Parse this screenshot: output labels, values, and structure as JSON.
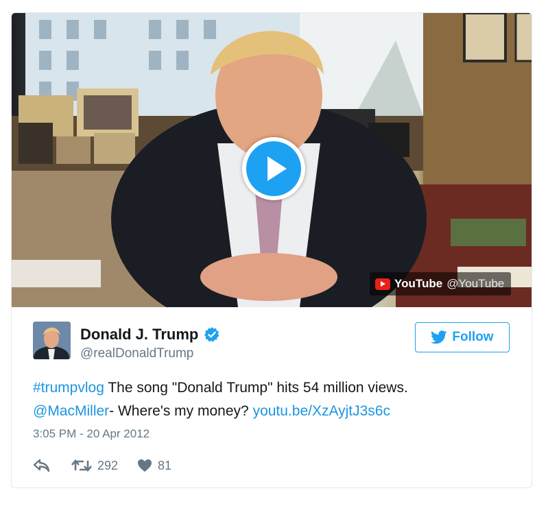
{
  "media": {
    "badge_brand": "YouTube",
    "badge_handle": "@YouTube"
  },
  "user": {
    "name": "Donald J. Trump",
    "screen_name": "@realDonaldTrump",
    "verified": true
  },
  "follow_label": "Follow",
  "tweet": {
    "hashtag": "#trumpvlog",
    "text_1": " The song \"Donald Trump\" hits 54 million views.",
    "mention": "@MacMiller",
    "text_2": "- Where's my money? ",
    "url": "youtu.be/XzAyjtJ3s6c",
    "timestamp": "3:05 PM - 20 Apr 2012"
  },
  "stats": {
    "retweets": "292",
    "likes": "81"
  },
  "icons": {
    "play": "play-icon",
    "youtube": "youtube-logo-icon",
    "verified": "verified-badge-icon",
    "twitter_bird": "twitter-bird-icon",
    "reply": "reply-icon",
    "retweet": "retweet-icon",
    "like": "heart-icon"
  },
  "colors": {
    "accent": "#1da1f2",
    "link": "#1b95e0",
    "text": "#14171a",
    "muted": "#657786",
    "border": "#e1e8ed"
  }
}
